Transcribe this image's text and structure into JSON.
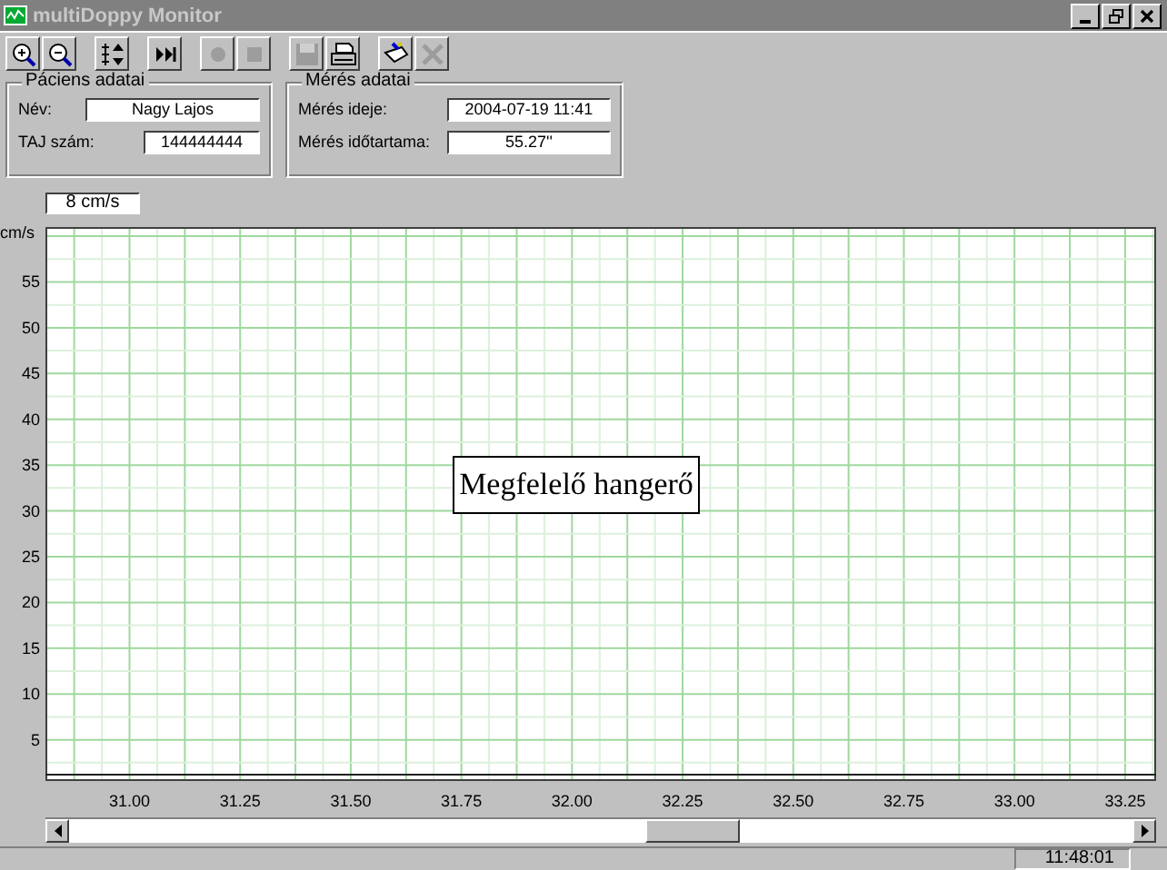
{
  "window": {
    "title": "multiDoppy Monitor",
    "active": false
  },
  "toolbar": [
    {
      "kind": "zoom-in",
      "disabled": false
    },
    {
      "kind": "zoom-out",
      "disabled": false
    },
    {
      "kind": "fit",
      "disabled": false
    },
    {
      "kind": "forward",
      "disabled": false
    },
    {
      "kind": "record",
      "disabled": true
    },
    {
      "kind": "stop",
      "disabled": true
    },
    {
      "kind": "save",
      "disabled": true
    },
    {
      "kind": "print",
      "disabled": false
    },
    {
      "kind": "tool",
      "disabled": false
    },
    {
      "kind": "close",
      "disabled": true
    }
  ],
  "patient": {
    "title": "Páciens adatai",
    "fields": [
      {
        "label": "Név:",
        "value": "Nagy Lajos"
      },
      {
        "label": "TAJ szám:",
        "value": "144444444"
      }
    ]
  },
  "measurement": {
    "title": "Mérés adatai",
    "fields": [
      {
        "label": "Mérés ideje:",
        "value": "2004-07-19 11:41"
      },
      {
        "label": "Mérés időtartama:",
        "value": "55.27''"
      }
    ]
  },
  "scale": {
    "value": "8 cm/s"
  },
  "plot": {
    "message": "Megfelelő hangerő",
    "chart_data": {
      "type": "line",
      "ylabel": "cm/s",
      "xlim": [
        30.81,
        33.32
      ],
      "ylim": [
        0.5,
        61
      ],
      "xticks": [
        {
          "value": 31,
          "label": "31.00"
        },
        {
          "value": 31.25,
          "label": "31.25"
        },
        {
          "value": 31.5,
          "label": "31.50"
        },
        {
          "value": 31.75,
          "label": "31.75"
        },
        {
          "value": 32,
          "label": "32.00"
        },
        {
          "value": 32.25,
          "label": "32.25"
        },
        {
          "value": 32.5,
          "label": "32.50"
        },
        {
          "value": 32.75,
          "label": "32.75"
        },
        {
          "value": 33,
          "label": "33.00"
        },
        {
          "value": 33.25,
          "label": "33.25"
        }
      ],
      "yticks": [
        5,
        10,
        15,
        20,
        25,
        30,
        35,
        40,
        45,
        50,
        55
      ],
      "grid": true,
      "ref_lines": [
        {
          "axis": "y",
          "value": 1.2
        }
      ]
    }
  },
  "status_bar": {
    "time": "11:48:01"
  }
}
